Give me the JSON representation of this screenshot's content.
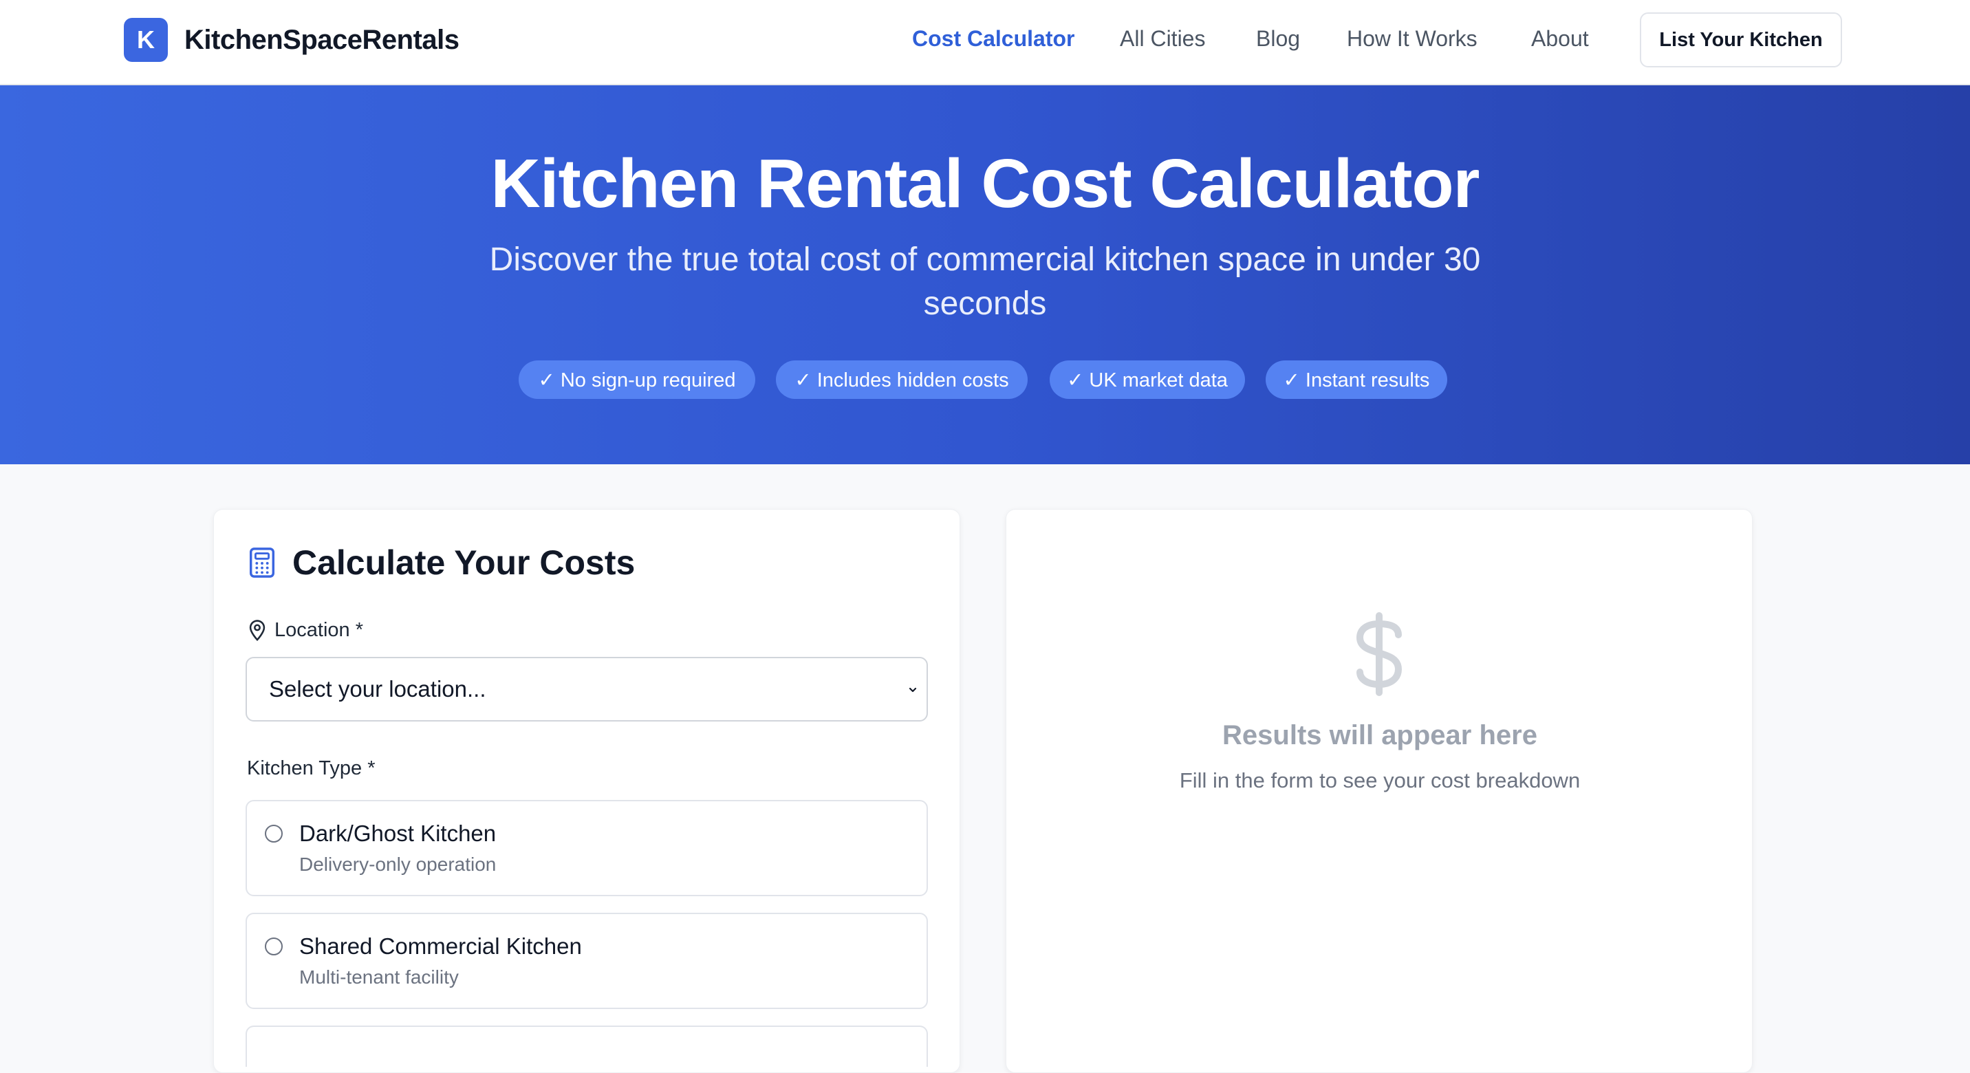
{
  "brand": {
    "logo_letter": "K",
    "name": "KitchenSpaceRentals"
  },
  "nav": {
    "items": [
      {
        "label": "Cost Calculator",
        "active": true
      },
      {
        "label": "All Cities"
      },
      {
        "label": "Blog"
      },
      {
        "label": "How It Works"
      },
      {
        "label": "About"
      }
    ],
    "cta_label": "List Your Kitchen"
  },
  "hero": {
    "title": "Kitchen Rental Cost Calculator",
    "subtitle": "Discover the true total cost of commercial kitchen space in under 30 seconds",
    "badges": [
      "✓ No sign-up required",
      "✓ Includes hidden costs",
      "✓ UK market data",
      "✓ Instant results"
    ]
  },
  "form": {
    "title": "Calculate Your Costs",
    "title_icon": "calculator-icon",
    "location": {
      "label": "Location *",
      "icon": "map-pin-icon",
      "selected": "Select your location..."
    },
    "kitchen_type": {
      "label": "Kitchen Type *",
      "options": [
        {
          "title": "Dark/Ghost Kitchen",
          "description": "Delivery-only operation"
        },
        {
          "title": "Shared Commercial Kitchen",
          "description": "Multi-tenant facility"
        }
      ]
    }
  },
  "results": {
    "icon": "dollar-icon",
    "title": "Results will appear here",
    "subtitle": "Fill in the form to see your cost breakdown"
  },
  "colors": {
    "accent": "#3b66e0",
    "nav_active": "#2f5fd8",
    "hero_start": "#3a67df",
    "hero_end": "#2640a8",
    "badge_bg": "#5582f2",
    "placeholder_text": "#9ca3af"
  }
}
